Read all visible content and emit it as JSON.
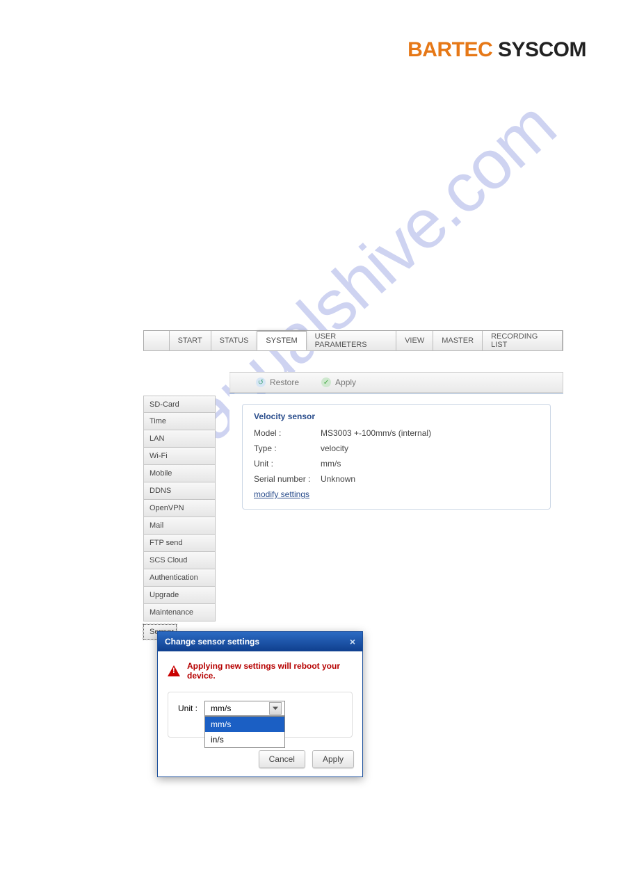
{
  "logo": {
    "part1": "BARTEC",
    "part2": " SYSCOM"
  },
  "watermark": "manualshive.com",
  "tabs": {
    "items": [
      "START",
      "STATUS",
      "SYSTEM",
      "USER PARAMETERS",
      "VIEW",
      "MASTER",
      "RECORDING LIST"
    ],
    "active_index": 2
  },
  "toolbar": {
    "restore": "Restore",
    "apply": "Apply"
  },
  "sidebar": {
    "items": [
      "SD-Card",
      "Time",
      "LAN",
      "Wi-Fi",
      "Mobile",
      "DDNS",
      "OpenVPN",
      "Mail",
      "FTP send",
      "SCS Cloud",
      "Authentication",
      "Upgrade",
      "Maintenance"
    ],
    "selected": "Sensor"
  },
  "panel": {
    "title": "Velocity sensor",
    "fields": {
      "model_label": "Model :",
      "model_value": "MS3003 +-100mm/s (internal)",
      "type_label": "Type :",
      "type_value": "velocity",
      "unit_label": "Unit :",
      "unit_value": "mm/s",
      "serial_label": "Serial number :",
      "serial_value": "Unknown"
    },
    "modify_link": "modify settings"
  },
  "dialog": {
    "title": "Change sensor settings",
    "warning": "Applying new settings will reboot your device.",
    "unit_label": "Unit :",
    "unit_selected": "mm/s",
    "options": [
      "mm/s",
      "in/s"
    ],
    "highlighted_index": 0,
    "cancel": "Cancel",
    "apply": "Apply"
  }
}
